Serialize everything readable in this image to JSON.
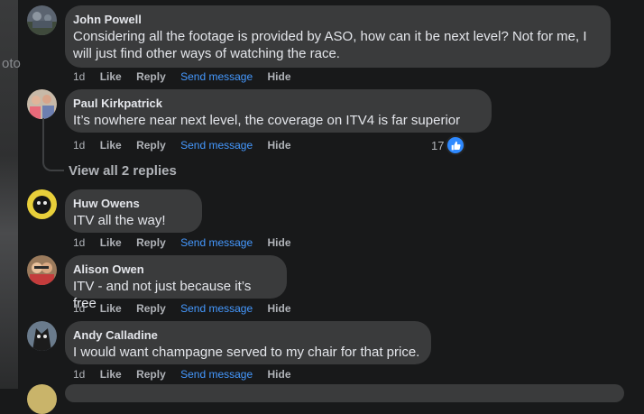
{
  "comments": [
    {
      "author": "John Powell",
      "text_line1": "Considering all the footage is provided by ASO, how can it be next level? Not for me, I",
      "text_line2": "will just find other ways of watching the race.",
      "time": "1d",
      "like": "Like",
      "reply": "Reply",
      "send": "Send message",
      "hide": "Hide"
    },
    {
      "author": "Paul Kirkpatrick",
      "text": "It’s nowhere near next level, the coverage on ITV4 is far superior",
      "time": "1d",
      "like": "Like",
      "reply": "Reply",
      "send": "Send message",
      "hide": "Hide",
      "reaction_count": "17",
      "view_replies": "View all 2 replies"
    },
    {
      "author": "Huw Owens",
      "text": "ITV all the way!",
      "time": "1d",
      "like": "Like",
      "reply": "Reply",
      "send": "Send message",
      "hide": "Hide"
    },
    {
      "author": "Alison Owen",
      "text": "ITV - and not just because it’s free",
      "time": "1d",
      "like": "Like",
      "reply": "Reply",
      "send": "Send message",
      "hide": "Hide"
    },
    {
      "author": "Andy Calladine",
      "text": "I would want champagne served to my chair for that price.",
      "time": "1d",
      "like": "Like",
      "reply": "Reply",
      "send": "Send message",
      "hide": "Hide"
    }
  ],
  "icons": {
    "like_reaction": "thumbs-up-icon"
  },
  "colors": {
    "background": "#18191a",
    "bubble": "#3a3b3c",
    "link": "#4599ff",
    "like_badge": "#2e89ff"
  }
}
